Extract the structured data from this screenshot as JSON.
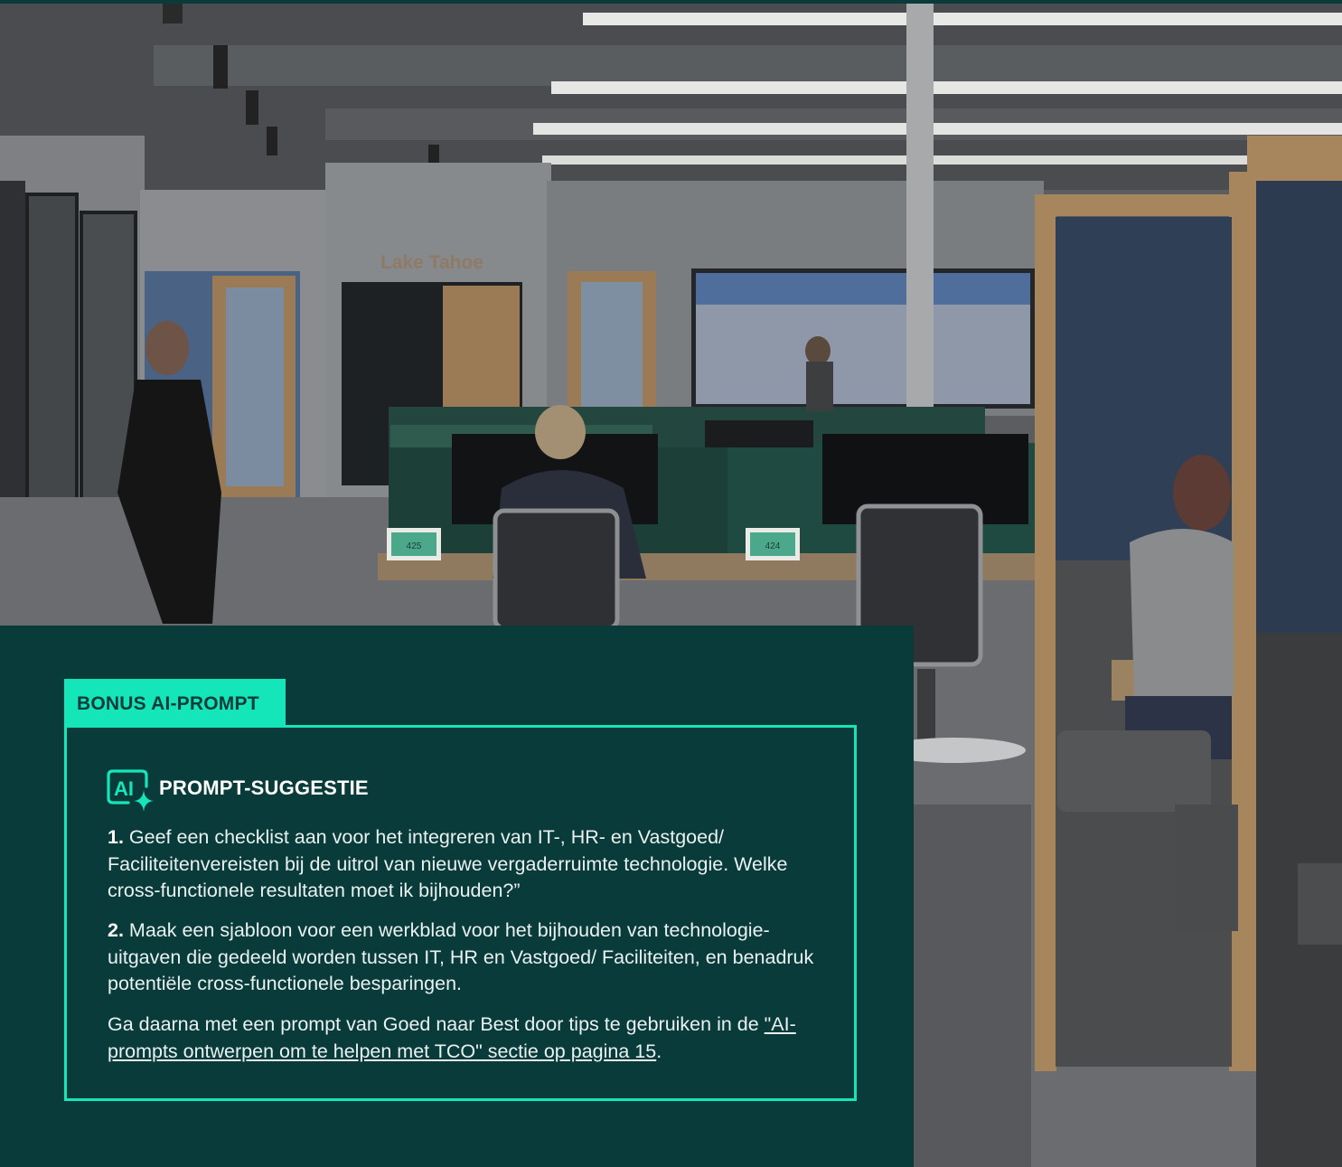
{
  "photo": {
    "sign_text": "Lake Tahoe",
    "booth_labels": [
      "425",
      "424"
    ]
  },
  "tag": {
    "label": "BONUS AI-PROMPT"
  },
  "card": {
    "icon_text": "AI",
    "title": "PROMPT-SUGGESTIE",
    "item1_number": "1.",
    "item1_text": "Geef een checklist aan voor het integreren van IT-, HR- en Vastgoed/ Faciliteitenvereisten bij de uitrol van nieuwe vergaderruimte technologie. Welke cross-functionele resultaten moet ik bijhouden?”",
    "item2_number": "2.",
    "item2_text": "Maak een sjabloon voor een werkblad voor het bijhouden van technologie-uitgaven die gedeeld worden tussen IT, HR en Vastgoed/ Faciliteiten, en benadruk potentiële cross-functionele besparingen.",
    "closing_text": "Ga daarna met een prompt van Goed naar Best door tips te gebruiken in de ",
    "closing_link": "\"AI-prompts ontwerpen om te helpen met TCO\" sectie op pagina 15",
    "closing_end": "."
  },
  "colors": {
    "panel": "#0a3b3b",
    "accent": "#14e6b9"
  }
}
